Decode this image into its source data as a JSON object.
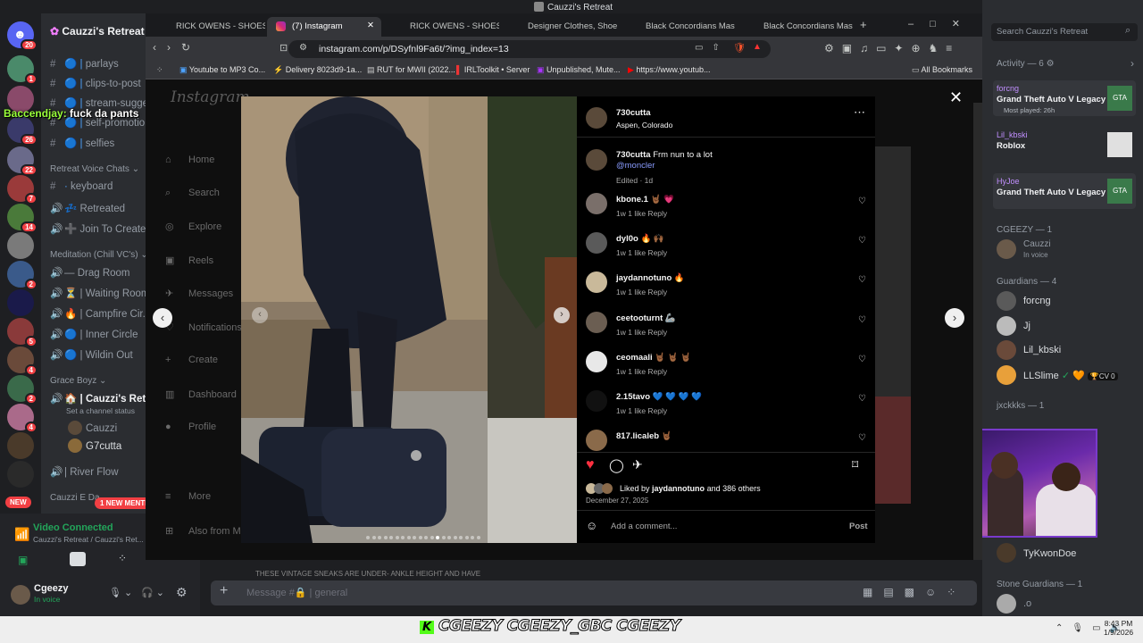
{
  "window_title": "Cauzzi's Retreat",
  "discord": {
    "server_name": "Cauzzi's Retreat",
    "home_badge": "20",
    "rail_badges": [
      "1",
      "26",
      "22",
      "7",
      "14",
      "2",
      "5",
      "4",
      "2",
      "4",
      "NEW"
    ],
    "channels": [
      {
        "prefix": "#",
        "label": "parlays"
      },
      {
        "prefix": "#",
        "label": "clips-to-post"
      },
      {
        "prefix": "#",
        "label": "stream-sugge..."
      },
      {
        "prefix": "#",
        "label": "self-promotio..."
      },
      {
        "prefix": "#",
        "label": "selfies"
      }
    ],
    "overlay_chat_user": "Baccendjay:",
    "overlay_chat_msg": "fuck da pants",
    "category_retreat_voice": "Retreat Voice Chats",
    "voice_channels": [
      {
        "prefix": "#",
        "label": "keyboard"
      },
      {
        "prefix": "🔊",
        "label": "Retreated"
      },
      {
        "prefix": "🔊",
        "label": "Join To Create"
      }
    ],
    "category_meditation": "Meditation (Chill VC's)",
    "meditation_channels": [
      {
        "prefix": "🔊",
        "label": "Drag Room"
      },
      {
        "prefix": "🔊",
        "label": "Waiting Room"
      },
      {
        "prefix": "🔊",
        "label": "Campfire Cir..."
      },
      {
        "prefix": "🔊",
        "label": "Inner Circle"
      },
      {
        "prefix": "🔊",
        "label": "Wildin Out"
      }
    ],
    "category_grace": "Grace Boyz",
    "active_voice": "Cauzzi's Retreat",
    "channel_status_hint": "Set a channel status",
    "voice_members": [
      "Cauzzi",
      "G7cutta"
    ],
    "river_flow": "River Flow",
    "category_cauzzi_e": "Cauzzi E Da...",
    "new_mentions": "1 NEW MENTION",
    "video_connected": "Video Connected",
    "video_connected_sub": "Cauzzi's Retreat / Cauzzi's Ret...",
    "user_name": "Cgeezy",
    "user_status": "In voice",
    "message_placeholder": "Message #🔒 | general",
    "bottom_strip_text": "THESE VINTAGE SNEAKS ARE UNDER- ANKLE HEIGHT AND HAVE"
  },
  "members": {
    "search_placeholder": "Search Cauzzi's Retreat",
    "activity_header": "Activity — 6",
    "activities": [
      {
        "user": "forcng",
        "game": "Grand Theft Auto V Legacy",
        "sub": "Most played: 26h"
      },
      {
        "user": "Lil_kbski",
        "game": "Roblox",
        "sub": ""
      },
      {
        "user": "HyJoe",
        "game": "Grand Theft Auto V Legacy",
        "sub": ""
      }
    ],
    "group_cgeezy": "CGEEZY — 1",
    "cgeezy_member": "Cauzzi",
    "cgeezy_member_sub": "In voice",
    "group_guardians": "Guardians — 4",
    "guardians": [
      "forcng",
      "Jj",
      "Lil_kbski",
      "LLSlime"
    ],
    "llslime_tag": "CV 0",
    "group_jxckkks": "jxckkks — 1",
    "tykwondoe": "TyKwonDoe",
    "group_stone": "Stone Guardians — 1",
    "stone_member": ".o"
  },
  "browser": {
    "tabs": [
      "RICK OWENS - SHOES - Ric",
      "(7) Instagram",
      "RICK OWENS - SHOES - Ric",
      "Designer Clothes, Shoes & |",
      "Black Concordians Mastodo",
      "Black Concordians Mastodo"
    ],
    "url": "instagram.com/p/DSyfnl9Fa6t/?img_index=13",
    "bookmarks": [
      "Youtube to MP3 Co...",
      "Delivery 8023d9-1a...",
      "RUT for MWII (2022...",
      "IRLToolkit • Server",
      "Unpublished, Mute...",
      "https://www.youtub..."
    ],
    "all_bookmarks": "All Bookmarks"
  },
  "instagram": {
    "logo": "Instagram",
    "nav": [
      "Home",
      "Search",
      "Explore",
      "Reels",
      "Messages",
      "Notifications",
      "Create",
      "Dashboard",
      "Profile",
      "More",
      "Also from Meta"
    ],
    "post_user": "730cutta",
    "post_location": "Aspen, Colorado",
    "caption_user": "730cutta",
    "caption_text": "Frm nun to a lot",
    "caption_mention": "@moncler",
    "caption_meta": "Edited · 1d",
    "comments": [
      {
        "user": "kbone.1",
        "text": "🤘🏾 💗",
        "meta": "1w   1 like   Reply",
        "av": "#7a6f6a"
      },
      {
        "user": "dyl0o",
        "text": "🔥 🙌🏾",
        "meta": "1w   1 like   Reply",
        "av": "#5a5a5a"
      },
      {
        "user": "jaydannotuno",
        "text": "🔥",
        "meta": "1w   1 like   Reply",
        "av": "#c9b99a"
      },
      {
        "user": "ceetooturnt",
        "text": "🦾",
        "meta": "1w   1 like   Reply",
        "av": "#6b5e52"
      },
      {
        "user": "ceomaali",
        "text": "🤘🏾 🤘🏾 🤘🏾",
        "meta": "1w   1 like   Reply",
        "av": "#e8e8e8"
      },
      {
        "user": "2.15tavo",
        "text": "💙 💙 💙 💙",
        "meta": "1w   1 like   Reply",
        "av": "#111111"
      },
      {
        "user": "817.licaleb",
        "text": "🤘🏾",
        "meta": "",
        "av": "#8a6a4a"
      }
    ],
    "liked_by_prefix": "Liked by",
    "liked_by_user": "jaydannotuno",
    "liked_by_suffix": "and 386 others",
    "date": "December 27, 2025",
    "comment_placeholder": "Add a comment...",
    "post_button": "Post",
    "carousel_total": 20,
    "carousel_active": 13
  },
  "overlay": {
    "banner": "CGEEZY   CGEEZY_GBC   CGEEZY"
  },
  "taskbar": {
    "time": "8:43 PM",
    "date": "1/9/2026"
  }
}
